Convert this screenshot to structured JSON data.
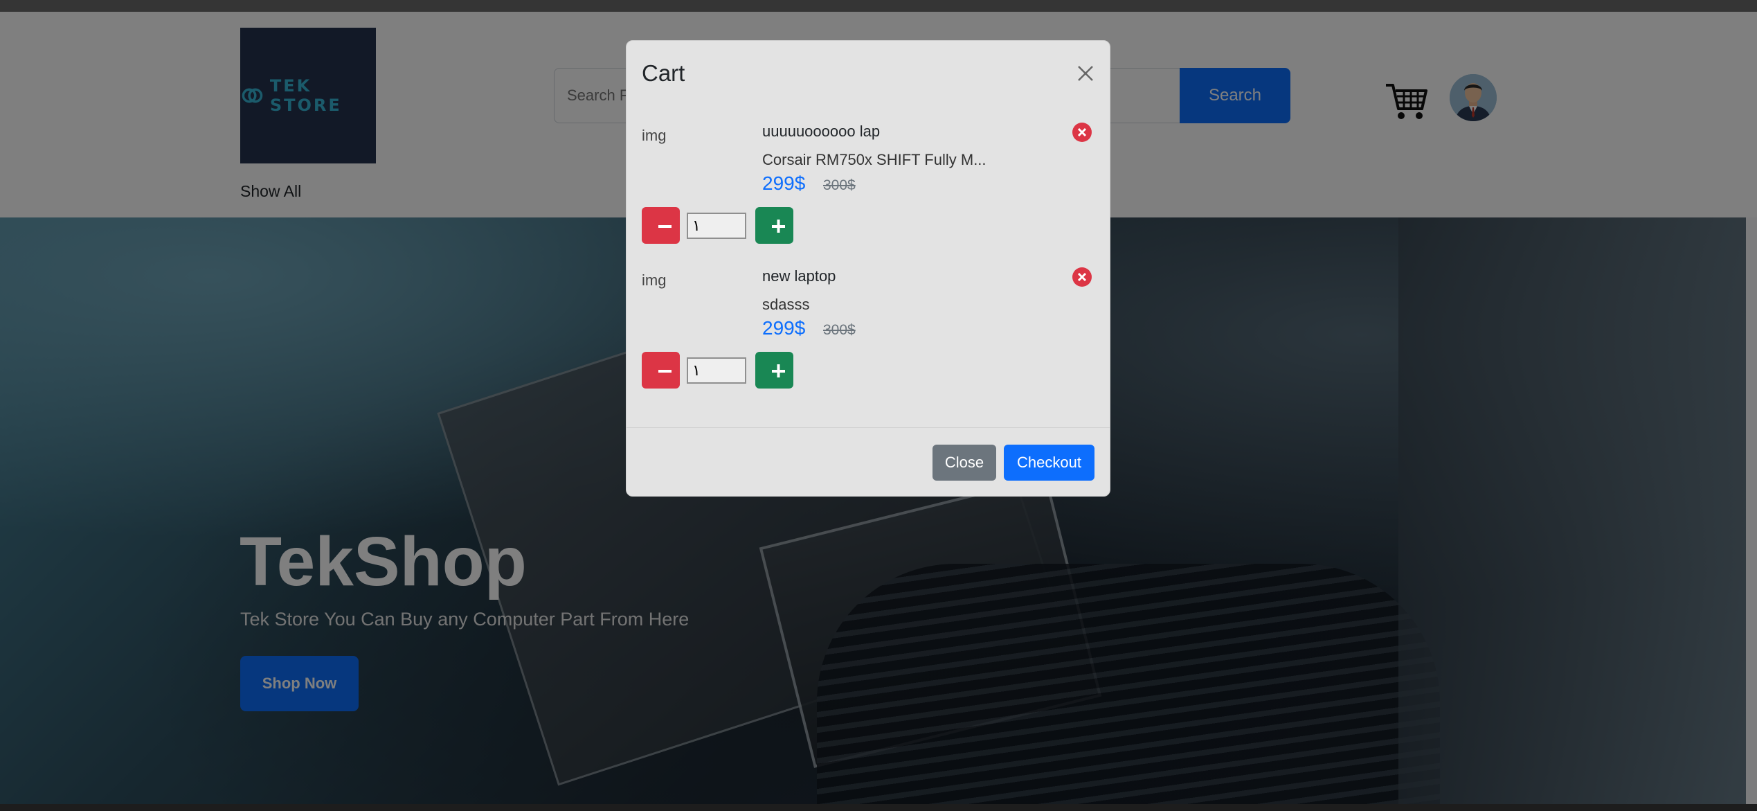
{
  "header": {
    "logo_text": "TEK STORE",
    "search_placeholder": "Search Fo",
    "search_button": "Search",
    "show_all": "Show All"
  },
  "hero": {
    "title": "TekShop",
    "subtitle": "Tek Store You Can Buy any Computer Part From Here",
    "shop_button": "Shop Now"
  },
  "cart": {
    "title": "Cart",
    "items": [
      {
        "img_alt": "img",
        "name": "uuuuuoooooo lap",
        "description": "Corsair RM750x SHIFT Fully M...",
        "price": "299$",
        "old_price": "300$",
        "quantity": "١"
      },
      {
        "img_alt": "img",
        "name": "new laptop",
        "description": "sdasss",
        "price": "299$",
        "old_price": "300$",
        "quantity": "١"
      }
    ],
    "close_button": "Close",
    "checkout_button": "Checkout"
  },
  "colors": {
    "primary": "#0d6efd",
    "danger": "#dc3545",
    "success": "#198754",
    "secondary": "#6c757d",
    "logo_bg": "#25324f",
    "logo_text": "#36b7d6"
  },
  "icons": [
    "logo-icon",
    "search-icon",
    "cart-icon",
    "avatar",
    "close-icon",
    "remove-icon",
    "minus-icon",
    "plus-icon"
  ]
}
